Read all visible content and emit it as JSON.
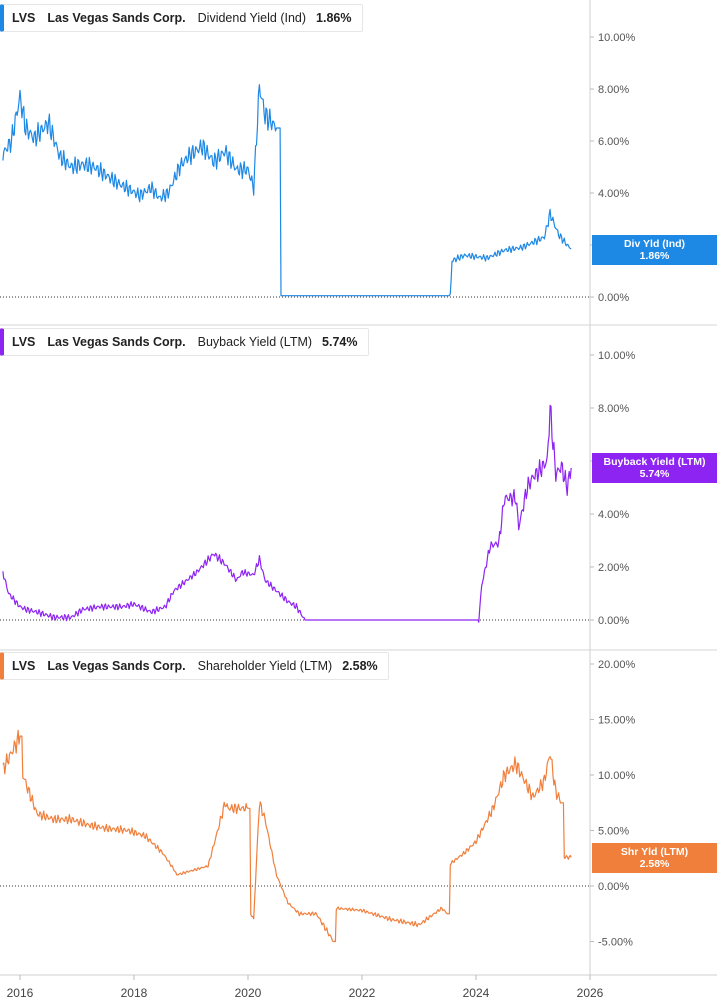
{
  "chart_data": [
    {
      "type": "line",
      "ticker": "LVS",
      "company": "Las Vegas Sands Corp.",
      "metric": "Dividend Yield (Ind)",
      "current_value": "1.86%",
      "tag_label": "Div Yld (Ind)",
      "tag_value": "1.86%",
      "color": "#1e88e5",
      "ylim": [
        0,
        11.5
      ],
      "yticks": [
        0,
        2,
        4,
        6,
        8,
        10
      ],
      "ytick_labels": [
        "0.00%",
        "2.00%",
        "4.00%",
        "6.00%",
        "8.00%",
        "10.00%"
      ],
      "x": [
        2015.7,
        2015.85,
        2016.0,
        2016.1,
        2016.25,
        2016.5,
        2016.7,
        2016.9,
        2017.1,
        2017.3,
        2017.5,
        2017.7,
        2017.95,
        2018.1,
        2018.3,
        2018.45,
        2018.6,
        2018.8,
        2018.95,
        2019.2,
        2019.4,
        2019.6,
        2019.8,
        2020.0,
        2020.1,
        2020.2,
        2020.3,
        2020.5,
        2020.58,
        2020.6,
        2021.0,
        2022.0,
        2023.0,
        2023.55,
        2023.58,
        2023.8,
        2024.2,
        2024.5,
        2024.8,
        2025.0,
        2025.2,
        2025.3,
        2025.45,
        2025.6,
        2025.67
      ],
      "y": [
        5.5,
        6.0,
        7.7,
        6.5,
        6.1,
        6.7,
        5.4,
        5.0,
        5.1,
        5.0,
        4.7,
        4.4,
        4.1,
        3.9,
        4.2,
        3.8,
        4.0,
        5.0,
        5.4,
        5.8,
        5.2,
        5.6,
        4.9,
        4.9,
        4.2,
        8.1,
        7.0,
        6.5,
        0.05,
        0.05,
        0.05,
        0.05,
        0.05,
        0.05,
        1.4,
        1.6,
        1.5,
        1.8,
        1.9,
        2.1,
        2.3,
        3.2,
        2.4,
        2.0,
        1.86
      ]
    },
    {
      "type": "line",
      "ticker": "LVS",
      "company": "Las Vegas Sands Corp.",
      "metric": "Buyback Yield (LTM)",
      "current_value": "5.74%",
      "tag_label": "Buyback Yield (LTM)",
      "tag_value": "5.74%",
      "color": "#8e24f2",
      "ylim": [
        0,
        10
      ],
      "yticks": [
        0,
        2,
        4,
        6,
        8,
        10
      ],
      "ytick_labels": [
        "0.00%",
        "2.00%",
        "4.00%",
        "6.00%",
        "8.00%",
        "10.00%"
      ],
      "x": [
        2015.7,
        2015.8,
        2016.0,
        2016.1,
        2016.3,
        2016.6,
        2016.9,
        2017.1,
        2017.4,
        2017.8,
        2018.0,
        2018.3,
        2018.55,
        2018.7,
        2019.1,
        2019.4,
        2019.6,
        2019.8,
        2019.9,
        2020.1,
        2020.2,
        2020.3,
        2020.5,
        2020.7,
        2020.85,
        2021.0,
        2022.0,
        2023.0,
        2023.7,
        2024.05,
        2024.1,
        2024.25,
        2024.4,
        2024.5,
        2024.7,
        2024.75,
        2024.9,
        2025.0,
        2025.1,
        2025.25,
        2025.3,
        2025.4,
        2025.5,
        2025.6,
        2025.67
      ],
      "y": [
        1.8,
        1.0,
        0.5,
        0.4,
        0.3,
        0.1,
        0.1,
        0.4,
        0.5,
        0.5,
        0.6,
        0.3,
        0.5,
        1.1,
        1.8,
        2.5,
        2.1,
        1.5,
        1.8,
        1.7,
        2.3,
        1.5,
        1.1,
        0.7,
        0.5,
        0.0,
        0.0,
        0.0,
        0.0,
        0.0,
        1.3,
        2.8,
        2.9,
        4.6,
        4.6,
        3.5,
        5.0,
        5.4,
        5.6,
        6.0,
        8.0,
        5.5,
        5.8,
        5.0,
        5.74
      ]
    },
    {
      "type": "line",
      "ticker": "LVS",
      "company": "Las Vegas Sands Corp.",
      "metric": "Shareholder Yield (LTM)",
      "current_value": "2.58%",
      "tag_label": "Shr Yld (LTM)",
      "tag_value": "2.58%",
      "color": "#f07f3c",
      "ylim": [
        -7,
        21
      ],
      "yticks": [
        -5,
        0,
        5,
        10,
        15,
        20
      ],
      "ytick_labels": [
        "-5.00%",
        "0.00%",
        "5.00%",
        "10.00%",
        "15.00%",
        "20.00%"
      ],
      "x": [
        2015.7,
        2015.85,
        2016.0,
        2016.05,
        2016.3,
        2016.6,
        2016.9,
        2017.2,
        2017.5,
        2017.9,
        2018.2,
        2018.5,
        2018.7,
        2018.75,
        2019.3,
        2019.6,
        2019.65,
        2020.0,
        2020.05,
        2020.1,
        2020.2,
        2020.3,
        2020.5,
        2020.7,
        2020.9,
        2021.2,
        2021.5,
        2021.55,
        2022.0,
        2022.5,
        2023.0,
        2023.4,
        2023.5,
        2023.55,
        2023.8,
        2024.0,
        2024.3,
        2024.5,
        2024.7,
        2025.0,
        2025.2,
        2025.3,
        2025.4,
        2025.5,
        2025.55,
        2025.67
      ],
      "y": [
        10.5,
        12.0,
        13.5,
        10.0,
        6.5,
        6.0,
        6.0,
        5.5,
        5.2,
        5.0,
        4.5,
        3.0,
        1.5,
        1.0,
        1.8,
        7.5,
        7.0,
        7.0,
        -2.5,
        -3.0,
        7.5,
        6.0,
        1.0,
        -1.5,
        -2.5,
        -2.5,
        -5.0,
        -2.0,
        -2.2,
        -3.0,
        -3.5,
        -2.0,
        -2.5,
        2.0,
        3.0,
        4.0,
        7.0,
        10.0,
        11.0,
        8.0,
        9.5,
        12.0,
        8.5,
        7.5,
        2.6,
        2.58
      ]
    }
  ],
  "x_axis": {
    "ticks": [
      2016,
      2018,
      2020,
      2022,
      2024,
      2026
    ],
    "tick_labels": [
      "2016",
      "2018",
      "2020",
      "2022",
      "2024",
      "2026"
    ],
    "range": [
      2015.65,
      2026.0
    ]
  }
}
